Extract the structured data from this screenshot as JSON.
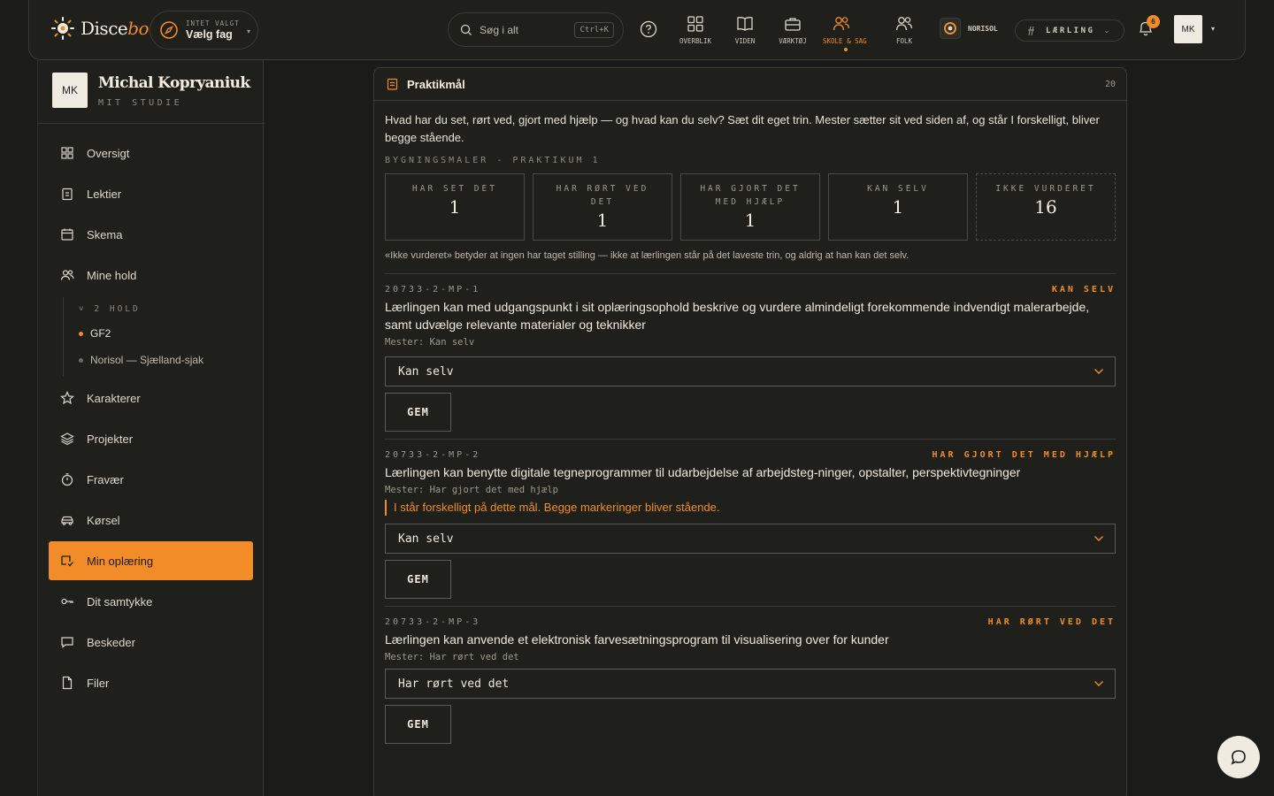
{
  "brand": {
    "name_main": "Disce",
    "name_accent": "bo"
  },
  "subject_picker": {
    "hint": "INTET VALGT",
    "label": "Vælg fag"
  },
  "search": {
    "placeholder": "Søg i alt",
    "shortcut": "Ctrl+K"
  },
  "nav": [
    {
      "label": "OVERBLIK",
      "icon": "grid-icon"
    },
    {
      "label": "VIDEN",
      "icon": "book-icon"
    },
    {
      "label": "VÆRKTØJ",
      "icon": "briefcase-icon"
    },
    {
      "label": "SKOLE & SAG",
      "icon": "people-icon",
      "active": true
    },
    {
      "label": "FOLK",
      "icon": "user-group-icon"
    }
  ],
  "org": {
    "name": "NORISOL"
  },
  "role": {
    "label": "LÆRLING"
  },
  "notifications": {
    "count": "6"
  },
  "user": {
    "initials": "MK",
    "name": "Michal Kopryaniuk",
    "subtitle": "MIT STUDIE"
  },
  "sidebar": {
    "items": [
      {
        "label": "Oversigt",
        "icon": "dashboard-icon"
      },
      {
        "label": "Lektier",
        "icon": "clipboard-icon"
      },
      {
        "label": "Skema",
        "icon": "calendar-icon"
      },
      {
        "label": "Mine hold",
        "icon": "users-icon"
      },
      {
        "label": "Karakterer",
        "icon": "star-icon"
      },
      {
        "label": "Projekter",
        "icon": "layers-icon"
      },
      {
        "label": "Fravær",
        "icon": "stopwatch-icon"
      },
      {
        "label": "Kørsel",
        "icon": "car-icon"
      },
      {
        "label": "Min oplæring",
        "icon": "training-icon",
        "active": true
      },
      {
        "label": "Dit samtykke",
        "icon": "key-icon"
      },
      {
        "label": "Beskeder",
        "icon": "message-icon"
      },
      {
        "label": "Filer",
        "icon": "file-icon"
      }
    ],
    "teams_header": "˅ 2 HOLD",
    "teams": [
      {
        "label": "GF2",
        "color": "#f28c28"
      },
      {
        "label": "Norisol — Sjælland-sjak",
        "color": "#6b6c66"
      }
    ]
  },
  "panel": {
    "title": "Praktikmål",
    "count": "20",
    "intro": "Hvad har du set, rørt ved, gjort med hjælp — og hvad kan du selv? Sæt dit eget trin. Mester sætter sit ved siden af, og står I forskelligt, bliver begge stående.",
    "section": "BYGNINGSMALER - PRAKTIKUM 1",
    "stats": [
      {
        "label": "HAR SET DET",
        "value": "1"
      },
      {
        "label": "HAR RØRT VED DET",
        "value": "1"
      },
      {
        "label": "HAR GJORT DET MED HJÆLP",
        "value": "1"
      },
      {
        "label": "KAN SELV",
        "value": "1"
      },
      {
        "label": "IKKE VURDERET",
        "value": "16"
      }
    ],
    "note": "«Ikke vurderet» betyder at ingen har taget stilling — ikke at lærlingen står på det laveste trin, og aldrig at han kan det selv.",
    "save_label": "GEM",
    "goals": [
      {
        "code": "20733-2-MP-1",
        "status": "KAN SELV",
        "text": "Lærlingen kan med udgangspunkt i sit oplæringsophold beskrive og vurdere almindeligt forekommende indvendigt malerarbejde, samt udvælge relevante materialer og teknikker",
        "mester": "Mester: Kan selv",
        "selected": "Kan selv"
      },
      {
        "code": "20733-2-MP-2",
        "status": "HAR GJORT DET MED HJÆLP",
        "text": "Lærlingen kan benytte digitale tegneprogrammer til udarbejdelse af arbejdsteg-ninger, opstalter, perspektivtegninger",
        "mester": "Mester: Har gjort det med hjælp",
        "warning": "I står forskelligt på dette mål. Begge markeringer bliver stående.",
        "selected": "Kan selv"
      },
      {
        "code": "20733-2-MP-3",
        "status": "HAR RØRT VED DET",
        "text": "Lærlingen kan anvende et elektronisk farvesætningsprogram til visualisering over for kunder",
        "mester": "Mester: Har rørt ved det",
        "selected": "Har rørt ved det"
      }
    ]
  },
  "colors": {
    "accent": "#f28c28",
    "background": "#1b1c19",
    "surface": "#1f201c",
    "border": "#3a3b35"
  }
}
